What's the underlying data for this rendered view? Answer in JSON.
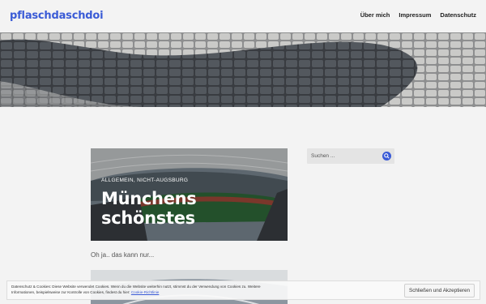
{
  "header": {
    "site_title": "pflaschdaschdoi",
    "nav": [
      "Über mich",
      "Impressum",
      "Datenschutz"
    ]
  },
  "post": {
    "categories": "ALLGEMEIN, NICHT-AUGSBURG",
    "title": "Münchens schönstes",
    "excerpt": "Oh ja.. das kann nur..."
  },
  "sidebar": {
    "search_placeholder": "Suchen ..."
  },
  "cookie_banner": {
    "text_part1": "Datenschutz & Cookies: Diese Website verwendet Cookies. Wenn du die Website weiterhin nutzt, stimmst du der Verwendung von Cookies zu.",
    "text_part2": "Weitere Informationen, beispielsweise zur Kontrolle von Cookies, findest du hier:",
    "link": "Cookie-Richtlinie",
    "button": "Schließen und Akzeptieren"
  },
  "colors": {
    "accent": "#3a5bd6",
    "background": "#f3f3f3"
  },
  "icons": {
    "search_button": "search-icon"
  }
}
